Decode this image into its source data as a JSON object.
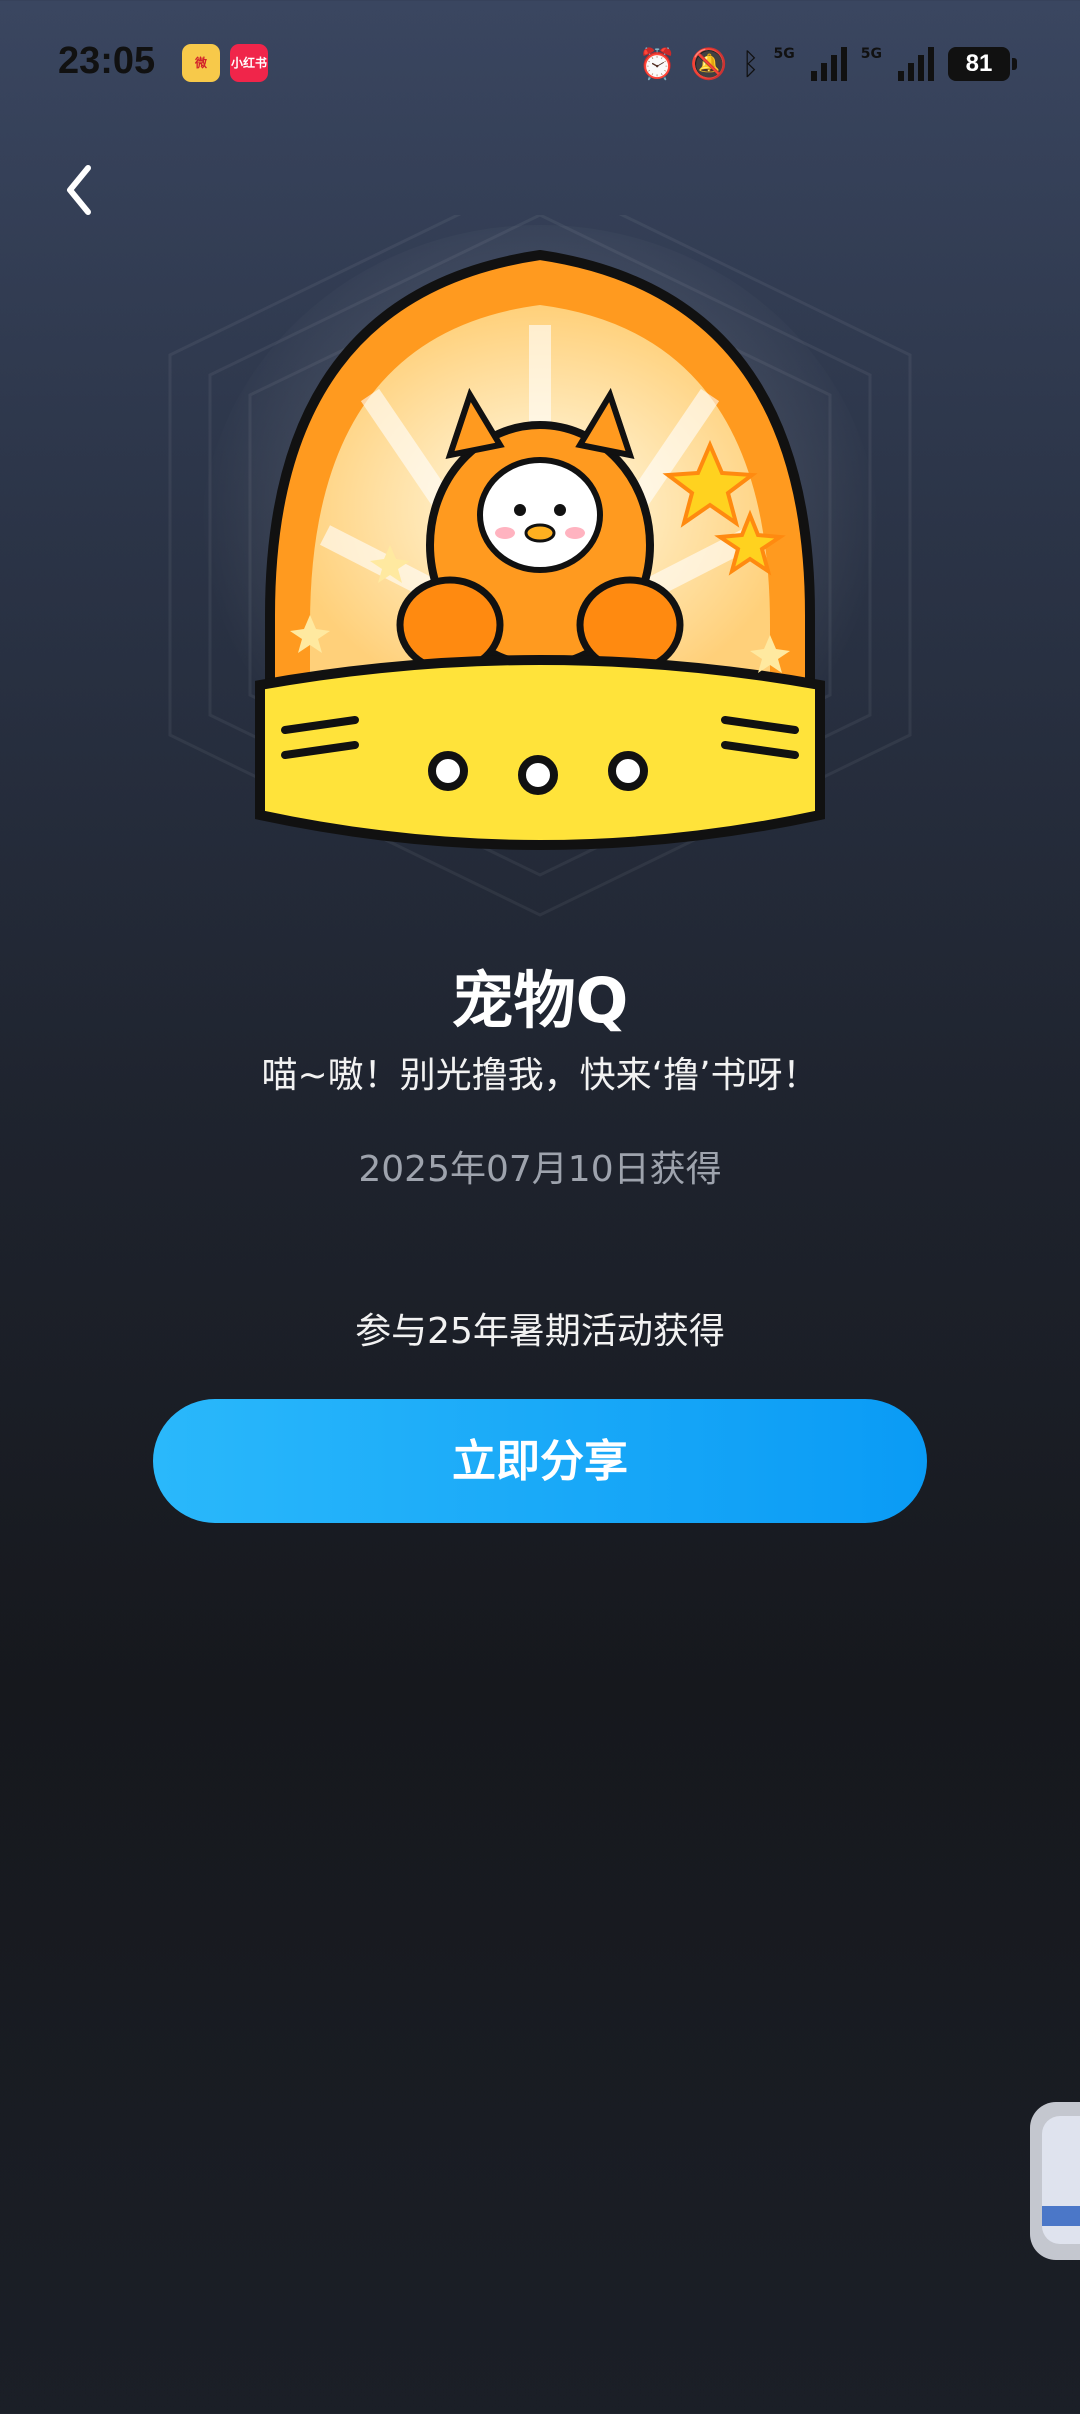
{
  "status_bar": {
    "time": "23:05",
    "apps": [
      {
        "name": "weibo-icon",
        "label": "微"
      },
      {
        "name": "xiaohongshu-icon",
        "label": "小红书"
      }
    ],
    "signal1_label": "5G",
    "signal2_label": "5G",
    "battery": "81"
  },
  "badge": {
    "title": "宠物Q",
    "description": "喵~嗷！别光撸我，快来‘撸’书呀！",
    "date": "2025年07月10日获得",
    "source": "参与25年暑期活动获得"
  },
  "actions": {
    "share_label": "立即分享"
  },
  "colors": {
    "button_start": "#2ab8fb",
    "button_end": "#0a9bf5",
    "badge_orange": "#ff9a1f",
    "badge_yellow": "#ffe33a"
  }
}
